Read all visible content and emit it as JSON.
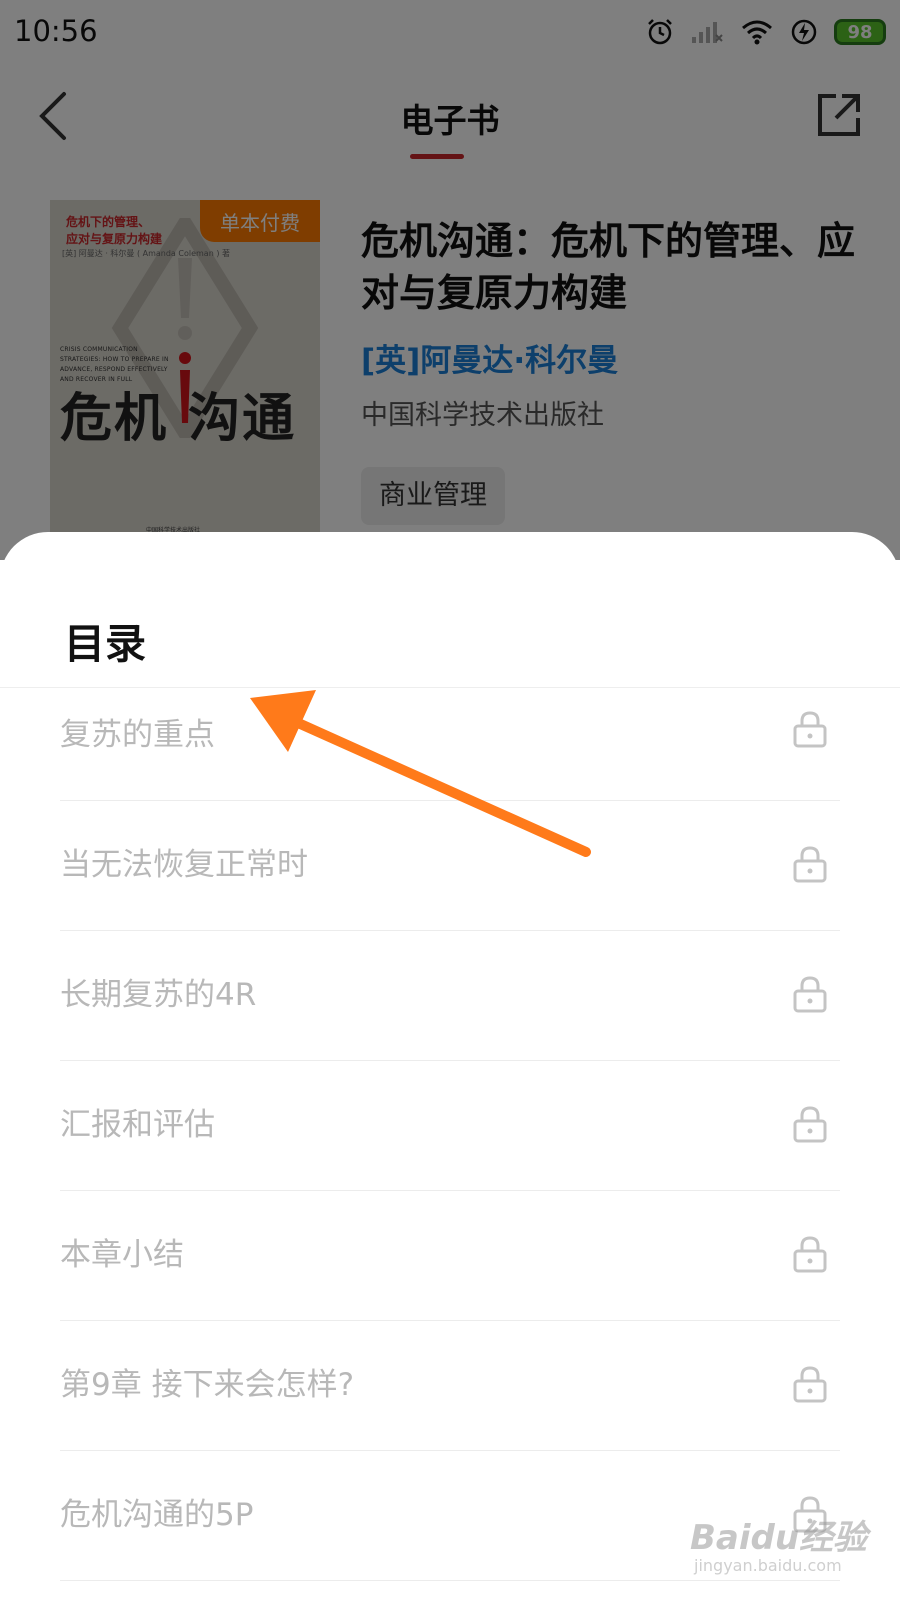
{
  "status_bar": {
    "time": "10:56",
    "battery": "98"
  },
  "nav": {
    "title": "电子书"
  },
  "book": {
    "cover": {
      "top_title_line1": "危机下的管理、",
      "top_title_line2": "应对与复原力构建",
      "author": "[英] 阿曼达 · 科尔曼 ( Amanda Coleman ) 著",
      "english_title": "CRISIS COMMUNICATION STRATEGIES: HOW TO PREPARE IN ADVANCE, RESPOND EFFECTIVELY AND RECOVER IN FULL",
      "big_title": "危机 沟通",
      "publisher": "中国科学技术出版社"
    },
    "badge": "单本付费",
    "title": "危机沟通：危机下的管理、应对与复原力构建",
    "author": "[英]阿曼达·科尔曼",
    "publisher": "中国科学技术出版社",
    "tag": "商业管理"
  },
  "toc": {
    "title": "目录",
    "items": [
      {
        "label": "复苏的重点"
      },
      {
        "label": "当无法恢复正常时"
      },
      {
        "label": "长期复苏的4R"
      },
      {
        "label": "汇报和评估"
      },
      {
        "label": "本章小结"
      },
      {
        "label": "第9章 接下来会怎样?"
      },
      {
        "label": "危机沟通的5P"
      }
    ]
  },
  "watermark": {
    "main": "Baidu经验",
    "sub": "jingyan.baidu.com"
  },
  "colors": {
    "accent_red": "#c8262a",
    "badge_orange": "#ff7a00",
    "author_blue": "#1a7fd6",
    "arrow_orange": "#ff7a1a"
  }
}
